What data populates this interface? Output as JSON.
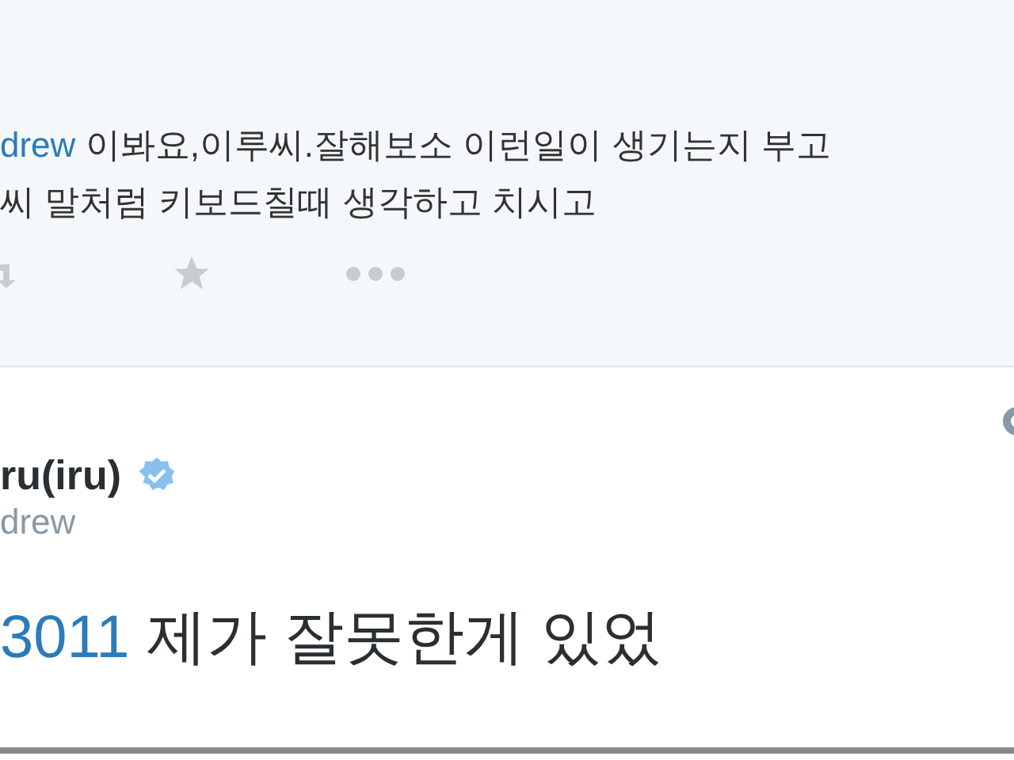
{
  "reply_tweet": {
    "mention": "drew",
    "text_line_1": "이봐요,이루씨.잘해보소 이런일이 생기는지 부고",
    "text_line_2": "씨 말처럼 키보드칠때 생각하고 치시고"
  },
  "main_tweet": {
    "name": "ru(iru)",
    "verified": true,
    "handle": "drew",
    "mention": "3011",
    "text": "제가 잘못한게 있었"
  }
}
